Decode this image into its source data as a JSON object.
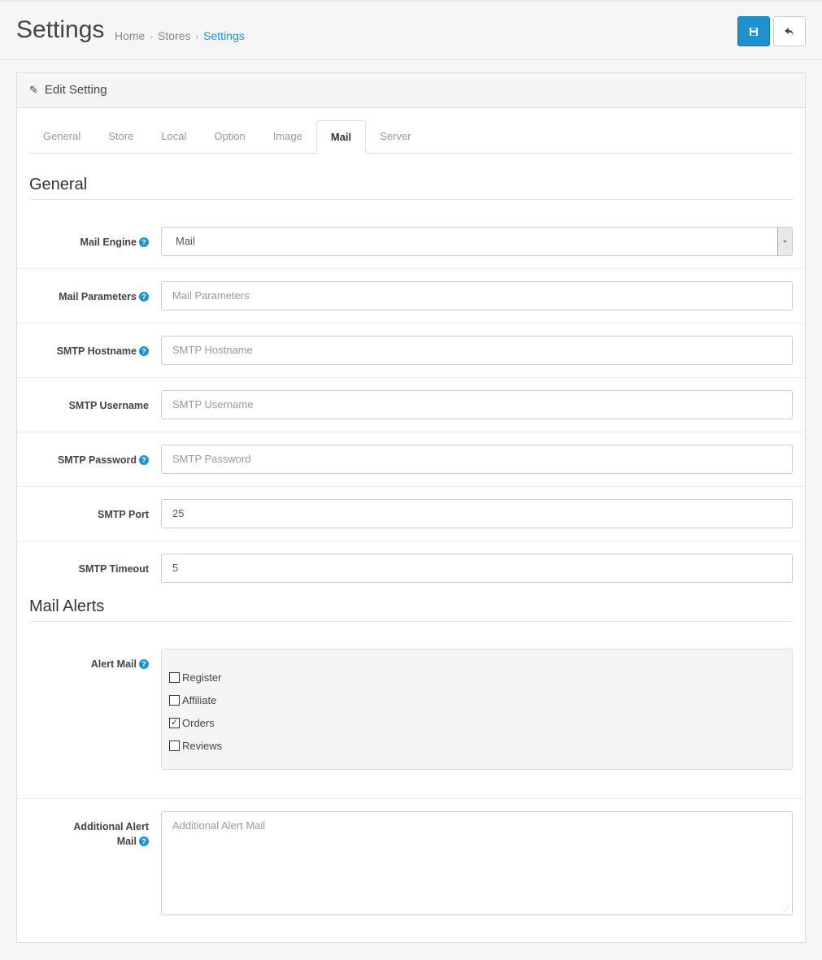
{
  "header": {
    "title": "Settings",
    "breadcrumb": [
      "Home",
      "Stores",
      "Settings"
    ],
    "save_icon": "floppy-disk-icon",
    "back_icon": "reply-icon"
  },
  "panel": {
    "heading": "Edit Setting",
    "heading_icon": "pencil-icon"
  },
  "tabs": [
    "General",
    "Store",
    "Local",
    "Option",
    "Image",
    "Mail",
    "Server"
  ],
  "active_tab": "Mail",
  "sections": {
    "general": "General",
    "alerts": "Mail Alerts"
  },
  "fields": {
    "mail_engine": {
      "label": "Mail Engine",
      "value": "Mail"
    },
    "mail_parameters": {
      "label": "Mail Parameters",
      "placeholder": "Mail Parameters"
    },
    "smtp_hostname": {
      "label": "SMTP Hostname",
      "placeholder": "SMTP Hostname"
    },
    "smtp_username": {
      "label": "SMTP Username",
      "placeholder": "SMTP Username"
    },
    "smtp_password": {
      "label": "SMTP Password",
      "placeholder": "SMTP Password"
    },
    "smtp_port": {
      "label": "SMTP Port",
      "value": "25"
    },
    "smtp_timeout": {
      "label": "SMTP Timeout",
      "value": "5"
    },
    "alert_mail": {
      "label": "Alert Mail",
      "options": [
        {
          "label": "Register",
          "checked": false
        },
        {
          "label": "Affiliate",
          "checked": false
        },
        {
          "label": "Orders",
          "checked": true
        },
        {
          "label": "Reviews",
          "checked": false
        }
      ]
    },
    "additional_alert_mail": {
      "label": "Additional Alert Mail",
      "placeholder": "Additional Alert Mail"
    }
  },
  "help_glyph": "?",
  "colors": {
    "primary": "#1e91cf"
  }
}
